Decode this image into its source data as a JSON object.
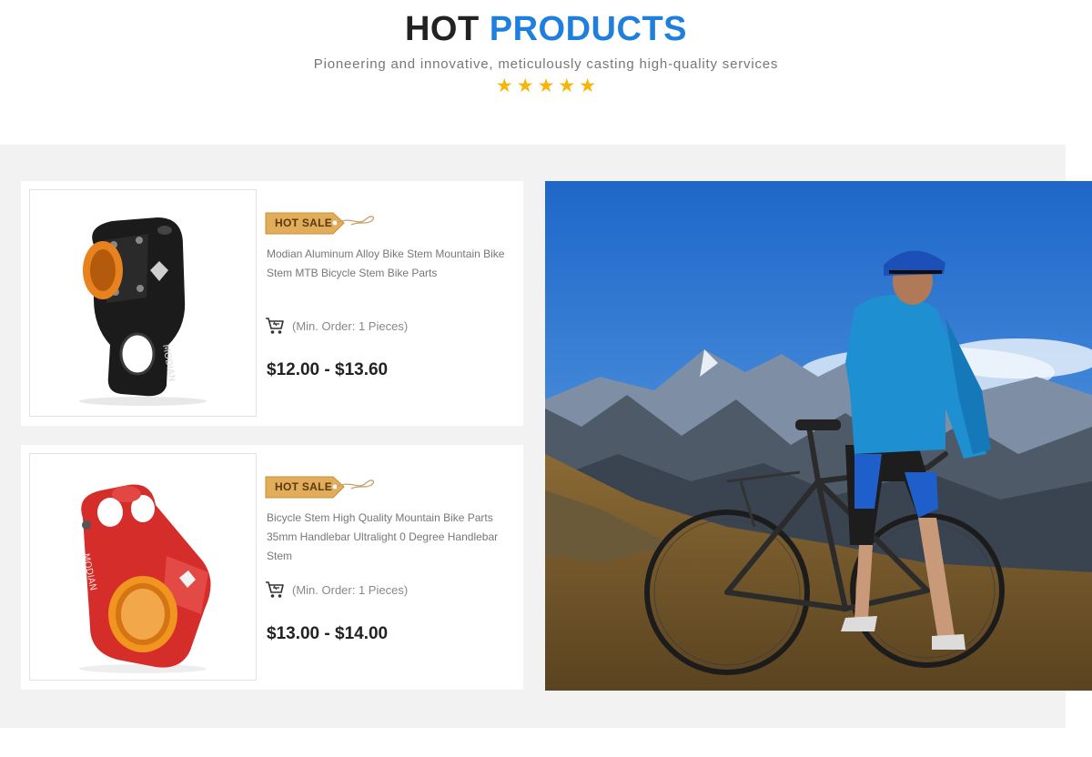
{
  "header": {
    "title_part1": "HOT",
    "title_part2": "PRODUCTS",
    "subtitle": "Pioneering and innovative, meticulously casting high-quality services",
    "rating": 5
  },
  "products": [
    {
      "badge": "HOT SALE",
      "name": "Modian Aluminum Alloy Bike Stem Mountain Bike Stem MTB Bicycle Stem Bike Parts",
      "min_order": "(Min. Order: 1 Pieces)",
      "price": "$12.00 - $13.60",
      "color": "black-orange"
    },
    {
      "badge": "HOT SALE",
      "name": "Bicycle Stem High Quality Mountain Bike Parts 35mm Handlebar Ultralight 0 Degree Handlebar Stem",
      "min_order": "(Min. Order: 1 Pieces)",
      "price": "$13.00 - $14.00",
      "color": "red-orange"
    }
  ],
  "colors": {
    "accent_blue": "#1f7fdc",
    "star": "#f5b50a",
    "panel_bg": "#f2f2f2"
  },
  "icons": [
    "star-icon",
    "cart-icon",
    "hot-sale-tag-icon"
  ]
}
